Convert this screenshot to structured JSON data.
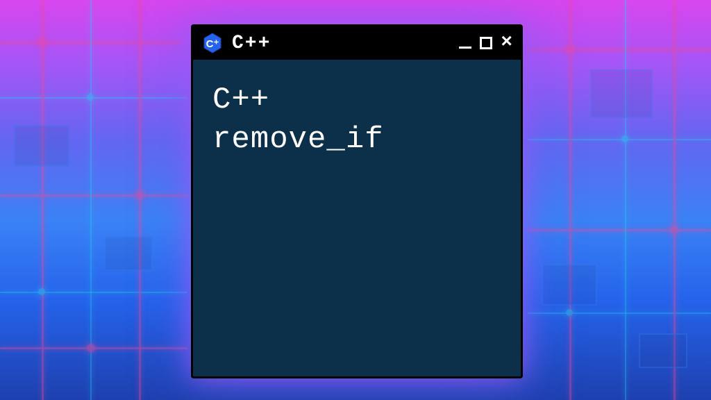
{
  "window": {
    "title": "C++",
    "icon_name": "cpp-icon"
  },
  "content": {
    "line1": "C++",
    "line2": "remove_if"
  }
}
